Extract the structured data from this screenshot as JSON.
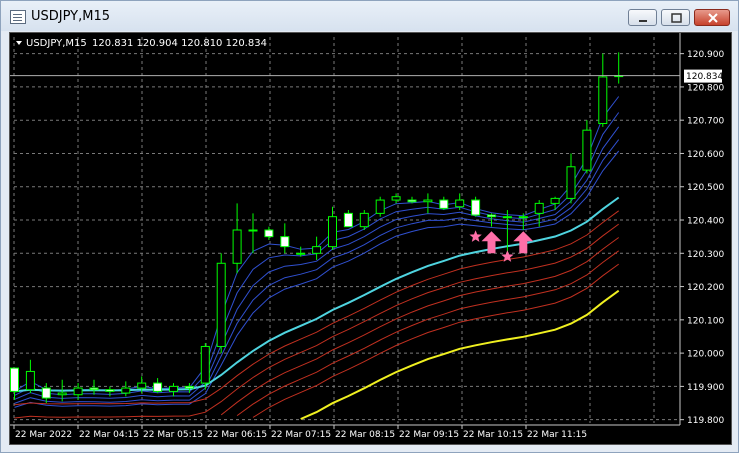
{
  "window": {
    "title": "USDJPY,M15"
  },
  "chart_header": {
    "symbol_label": "USDJPY,M15",
    "ohlc": "120.831 120.904 120.810 120.834"
  },
  "colors": {
    "background": "#000000",
    "bull": "#00ff00",
    "bear": "#00ff00",
    "current_price_line": "#b0b0b0",
    "ma_cyan": "#4fd4e0",
    "ma_yellow": "#f0f020",
    "ma_blue": "#3050d0",
    "ma_red": "#c03020",
    "signal": "#ff6fa8"
  },
  "chart_data": {
    "type": "candlestick",
    "y_ticks": [
      "120.900",
      "120.800",
      "120.700",
      "120.600",
      "120.500",
      "120.400",
      "120.300",
      "120.200",
      "120.100",
      "120.000",
      "119.900",
      "119.800"
    ],
    "ylim": [
      119.79,
      120.95
    ],
    "current_price": "120.834",
    "x_ticks": [
      "22 Mar 2022",
      "22 Mar 04:15",
      "22 Mar 05:15",
      "22 Mar 06:15",
      "22 Mar 07:15",
      "22 Mar 08:15",
      "22 Mar 09:15",
      "22 Mar 10:15",
      "22 Mar 11:15"
    ],
    "candles": [
      {
        "o": 119.955,
        "h": 119.955,
        "l": 119.86,
        "c": 119.885
      },
      {
        "o": 119.89,
        "h": 119.98,
        "l": 119.88,
        "c": 119.945
      },
      {
        "o": 119.895,
        "h": 119.91,
        "l": 119.85,
        "c": 119.865
      },
      {
        "o": 119.875,
        "h": 119.92,
        "l": 119.855,
        "c": 119.88
      },
      {
        "o": 119.875,
        "h": 119.91,
        "l": 119.86,
        "c": 119.895
      },
      {
        "o": 119.895,
        "h": 119.92,
        "l": 119.875,
        "c": 119.89
      },
      {
        "o": 119.89,
        "h": 119.9,
        "l": 119.87,
        "c": 119.885
      },
      {
        "o": 119.88,
        "h": 119.915,
        "l": 119.87,
        "c": 119.895
      },
      {
        "o": 119.895,
        "h": 119.93,
        "l": 119.88,
        "c": 119.91
      },
      {
        "o": 119.91,
        "h": 119.925,
        "l": 119.88,
        "c": 119.885
      },
      {
        "o": 119.885,
        "h": 119.91,
        "l": 119.87,
        "c": 119.9
      },
      {
        "o": 119.9,
        "h": 119.91,
        "l": 119.88,
        "c": 119.895
      },
      {
        "o": 119.91,
        "h": 120.03,
        "l": 119.89,
        "c": 120.02
      },
      {
        "o": 120.02,
        "h": 120.3,
        "l": 120.0,
        "c": 120.27
      },
      {
        "o": 120.27,
        "h": 120.45,
        "l": 120.24,
        "c": 120.37
      },
      {
        "o": 120.37,
        "h": 120.42,
        "l": 120.3,
        "c": 120.37
      },
      {
        "o": 120.37,
        "h": 120.38,
        "l": 120.34,
        "c": 120.35
      },
      {
        "o": 120.35,
        "h": 120.39,
        "l": 120.3,
        "c": 120.32
      },
      {
        "o": 120.3,
        "h": 120.32,
        "l": 120.29,
        "c": 120.3
      },
      {
        "o": 120.3,
        "h": 120.35,
        "l": 120.28,
        "c": 120.32
      },
      {
        "o": 120.32,
        "h": 120.44,
        "l": 120.31,
        "c": 120.41
      },
      {
        "o": 120.42,
        "h": 120.43,
        "l": 120.38,
        "c": 120.38
      },
      {
        "o": 120.38,
        "h": 120.43,
        "l": 120.37,
        "c": 120.42
      },
      {
        "o": 120.42,
        "h": 120.47,
        "l": 120.41,
        "c": 120.46
      },
      {
        "o": 120.46,
        "h": 120.48,
        "l": 120.45,
        "c": 120.47
      },
      {
        "o": 120.46,
        "h": 120.47,
        "l": 120.45,
        "c": 120.455
      },
      {
        "o": 120.455,
        "h": 120.48,
        "l": 120.42,
        "c": 120.46
      },
      {
        "o": 120.46,
        "h": 120.47,
        "l": 120.43,
        "c": 120.435
      },
      {
        "o": 120.44,
        "h": 120.48,
        "l": 120.43,
        "c": 120.46
      },
      {
        "o": 120.46,
        "h": 120.47,
        "l": 120.41,
        "c": 120.415
      },
      {
        "o": 120.415,
        "h": 120.42,
        "l": 120.38,
        "c": 120.41
      },
      {
        "o": 120.41,
        "h": 120.43,
        "l": 120.3,
        "c": 120.41
      },
      {
        "o": 120.41,
        "h": 120.42,
        "l": 120.37,
        "c": 120.41
      },
      {
        "o": 120.42,
        "h": 120.46,
        "l": 120.38,
        "c": 120.45
      },
      {
        "o": 120.45,
        "h": 120.47,
        "l": 120.43,
        "c": 120.465
      },
      {
        "o": 120.465,
        "h": 120.6,
        "l": 120.45,
        "c": 120.56
      },
      {
        "o": 120.55,
        "h": 120.7,
        "l": 120.54,
        "c": 120.67
      },
      {
        "o": 120.69,
        "h": 120.9,
        "l": 120.68,
        "c": 120.83
      },
      {
        "o": 120.831,
        "h": 120.904,
        "l": 120.81,
        "c": 120.834
      }
    ],
    "markers": [
      {
        "kind": "star",
        "bar": 29,
        "price": 120.35
      },
      {
        "kind": "arrow_up",
        "bar": 30,
        "price": 120.33
      },
      {
        "kind": "star",
        "bar": 31,
        "price": 120.29
      },
      {
        "kind": "arrow_up",
        "bar": 32,
        "price": 120.33
      }
    ]
  }
}
